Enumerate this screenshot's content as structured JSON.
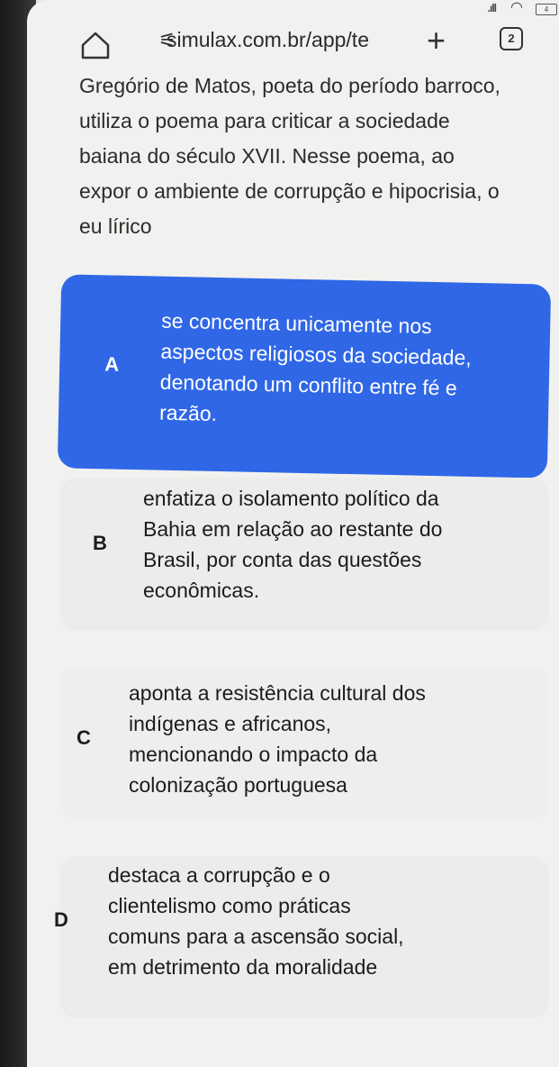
{
  "browser": {
    "url": "simulax.com.br/app/te",
    "tab_count": "2",
    "battery": "4"
  },
  "question": {
    "lines": [
      "Gregório de Matos, poeta do período barroco,",
      "utiliza o poema para criticar a sociedade",
      "baiana do século XVII. Nesse poema, ao",
      "expor o ambiente de corrupção e hipocrisia, o",
      "eu lírico"
    ]
  },
  "options": [
    {
      "letter": "A",
      "selected": true,
      "lines": [
        "se concentra unicamente nos",
        "aspectos religiosos da sociedade,",
        "denotando um conflito entre fé e",
        "razão."
      ]
    },
    {
      "letter": "B",
      "selected": false,
      "lines": [
        "enfatiza o isolamento político da",
        "Bahia em relação ao restante do",
        "Brasil, por conta das questões",
        "econômicas."
      ]
    },
    {
      "letter": "C",
      "selected": false,
      "lines": [
        "aponta a resistência cultural dos",
        "indígenas e africanos,",
        "mencionando o impacto da",
        "colonização portuguesa"
      ]
    },
    {
      "letter": "D",
      "selected": false,
      "lines": [
        "destaca a corrupção e o",
        "clientelismo como práticas",
        "comuns para a ascensão social,",
        "em detrimento da moralidade"
      ]
    }
  ],
  "colors": {
    "selected_bg": "#2f67e6",
    "option_bg": "#ececea"
  }
}
